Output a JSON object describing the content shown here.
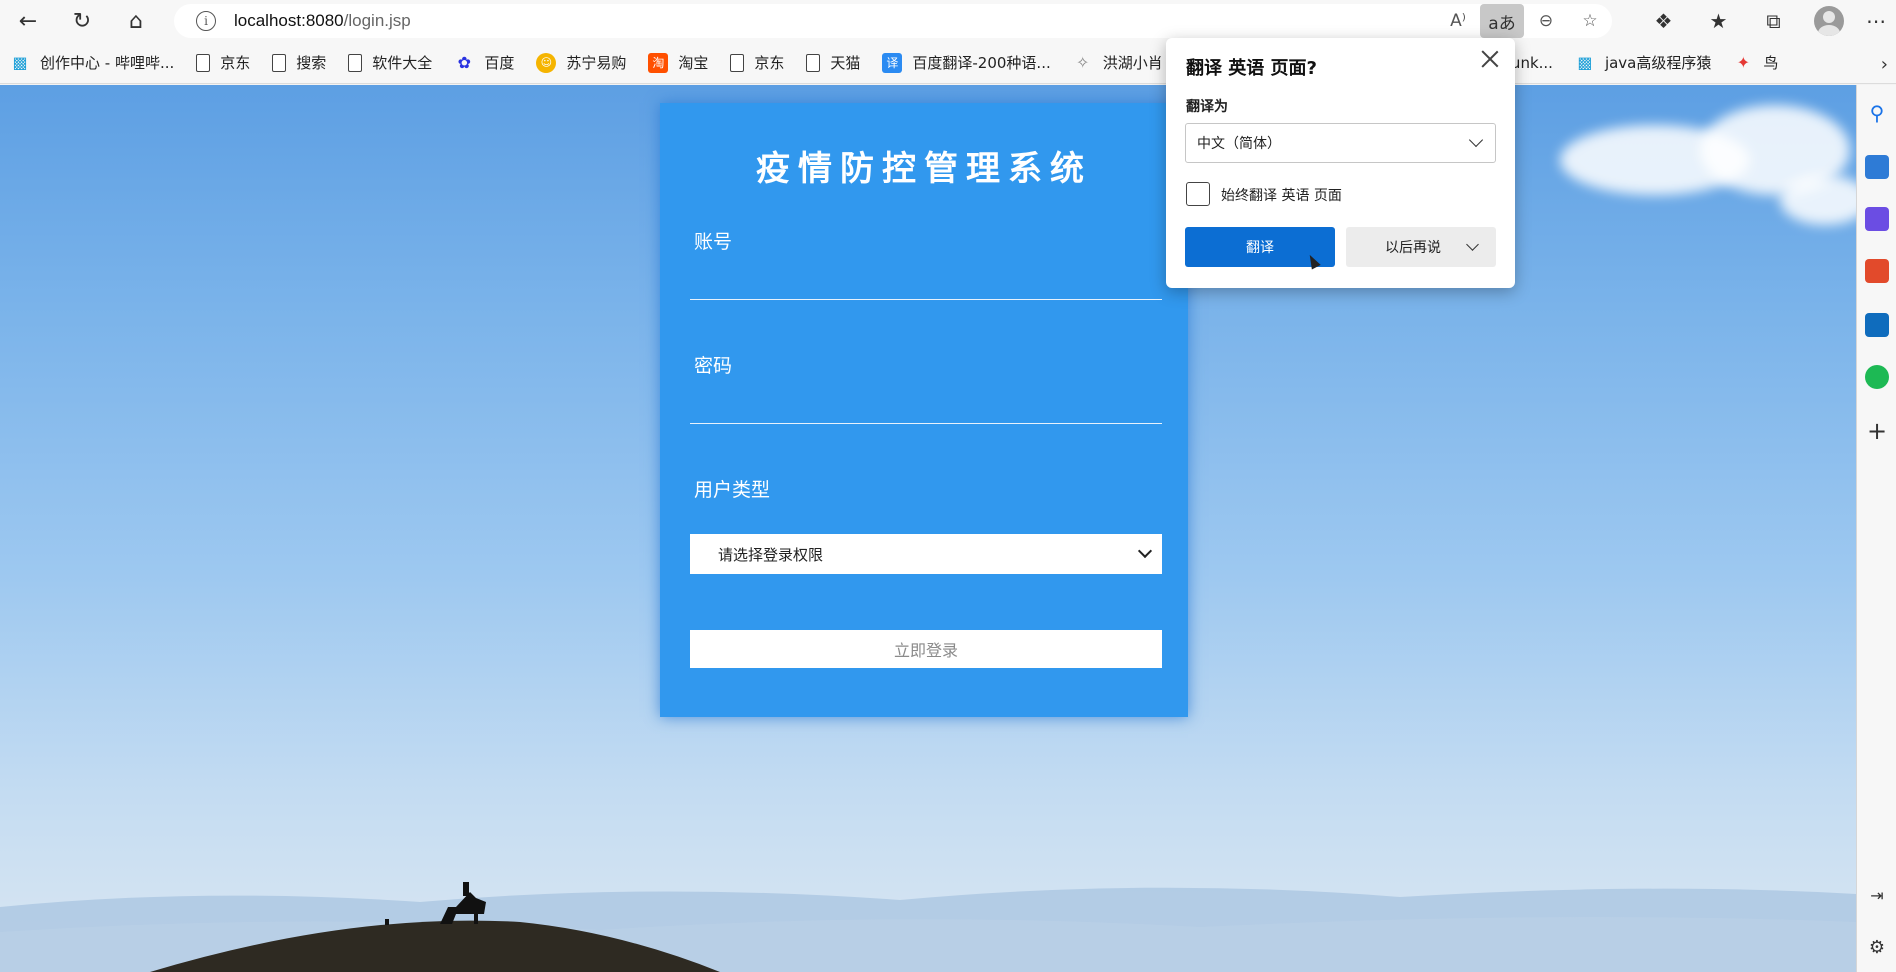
{
  "browser": {
    "url_host": "localhost:8080",
    "url_path": "/login.jsp"
  },
  "bookmarks": [
    {
      "label": "创作中心 - 哔哩哔...",
      "icon": "bilibili-icon"
    },
    {
      "label": "京东",
      "icon": "page-icon"
    },
    {
      "label": "搜索",
      "icon": "page-icon"
    },
    {
      "label": "软件大全",
      "icon": "page-icon"
    },
    {
      "label": "百度",
      "icon": "baidu-icon"
    },
    {
      "label": "苏宁易购",
      "icon": "suning-icon"
    },
    {
      "label": "淘宝",
      "icon": "taobao-icon"
    },
    {
      "label": "京东",
      "icon": "page-icon"
    },
    {
      "label": "天猫",
      "icon": "page-icon"
    },
    {
      "label": "百度翻译-200种语...",
      "icon": "fanyi-icon"
    },
    {
      "label": "洪湖小肖",
      "icon": "page-icon"
    },
    {
      "label": "runk...",
      "icon": "page-icon"
    },
    {
      "label": "java高级程序猿",
      "icon": "bilibili-icon"
    },
    {
      "label": "鸟",
      "icon": "bird-icon"
    }
  ],
  "login": {
    "title": "疫情防控管理系统",
    "account_label": "账号",
    "password_label": "密码",
    "user_type_label": "用户类型",
    "user_type_selected": "请选择登录权限",
    "submit_label": "立即登录"
  },
  "translate_popup": {
    "title": "翻译 英语 页面?",
    "translate_to_label": "翻译为",
    "language_selected": "中文（简体）",
    "always_translate_label": "始终翻译 英语 页面",
    "translate_button": "翻译",
    "later_button": "以后再说"
  },
  "colors": {
    "login_card": "#3198ee",
    "translate_button": "#0c6ed3",
    "sky_top": "#5d9fe3",
    "sky_bottom": "#dbe7f2"
  }
}
